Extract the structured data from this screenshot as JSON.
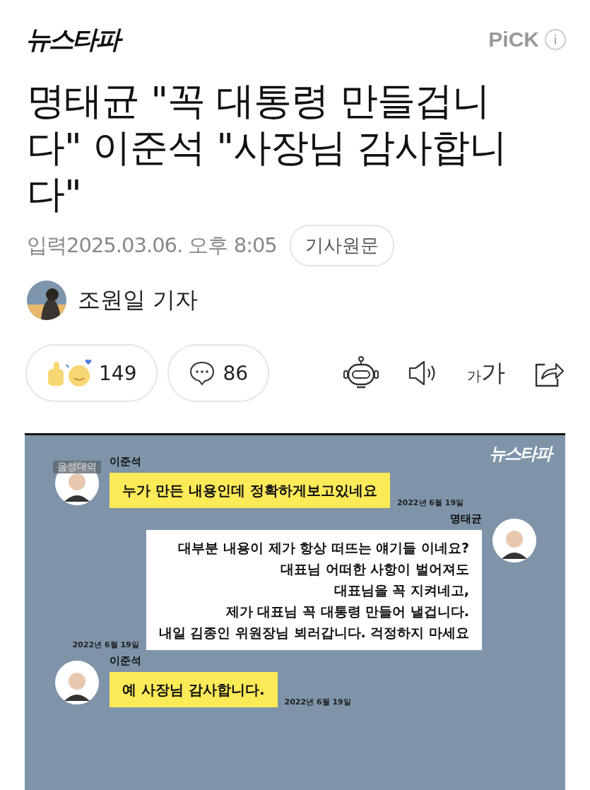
{
  "header": {
    "logo": "뉴스타파",
    "pick": "PiCK",
    "info": "i"
  },
  "article": {
    "title": "명태균 \"꼭 대통령 만들겁니다\" 이준석 \"사장님 감사합니다\"",
    "published": "입력2025.03.06. 오후 8:05",
    "original_link": "기사원문",
    "author": "조원일 기자"
  },
  "actions": {
    "reactions": "149",
    "comments": "86",
    "font_small": "가",
    "font_large": "가"
  },
  "image": {
    "logo": "뉴스타파",
    "caption_tag": "음성대역",
    "messages": [
      {
        "kind": "left",
        "name": "이준석",
        "text": "누가 만든 내용인데 정확하게보고있네요",
        "date": "2022년 6월 19일"
      },
      {
        "kind": "right",
        "name": "명태균",
        "text": "대부분 내용이 제가 항상 떠뜨는 얘기들 이네요?\n대표님 어떠한 사항이 벌어져도\n대표님을 꼭 지켜네고,\n제가 대표님 꼭 대통령 만들어 낼겁니다.\n내일 김종인 위원장님 뵈러갑니다. 걱정하지 마세요",
        "date": "2022년 6월 19일"
      },
      {
        "kind": "left",
        "name": "이준석",
        "text": "예 사장님 감사합니다.",
        "date": "2022년 6월 19일"
      }
    ]
  }
}
